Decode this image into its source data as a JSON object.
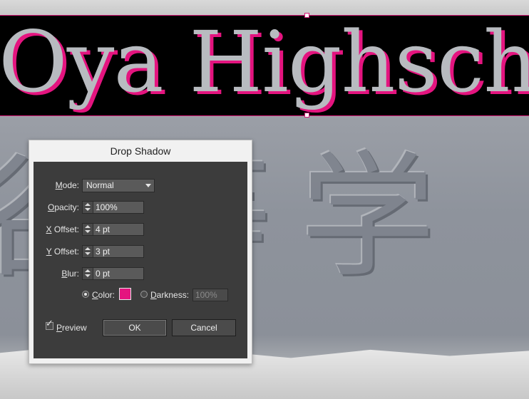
{
  "document": {
    "title_text": "Oya Highscho",
    "background_glyphs": "谷 等 学"
  },
  "dialog": {
    "title": "Drop Shadow",
    "mode": {
      "label_prefix": "",
      "label_ul": "M",
      "label_rest": "ode:",
      "value": "Normal"
    },
    "opacity": {
      "label_ul": "O",
      "label_rest": "pacity:",
      "value": "100%"
    },
    "x_offset": {
      "label_ul": "X",
      "label_rest": " Offset:",
      "value": "4 pt"
    },
    "y_offset": {
      "label_ul": "Y",
      "label_rest": " Offset:",
      "value": "3 pt"
    },
    "blur": {
      "label_ul": "B",
      "label_rest": "lur:",
      "value": "0 pt"
    },
    "color": {
      "label_ul": "C",
      "label_rest": "olor:",
      "selected": true,
      "swatch": "#e4147f"
    },
    "darkness": {
      "label_ul": "D",
      "label_rest": "arkness:",
      "value": "100%",
      "selected": false
    },
    "preview": {
      "label_ul": "P",
      "label_rest": "review",
      "checked": true
    },
    "ok_label": "OK",
    "cancel_label": "Cancel"
  },
  "colors": {
    "shadow": "#e4147f",
    "selection": "#d61b78",
    "dialog_panel": "#3c3c3c"
  }
}
